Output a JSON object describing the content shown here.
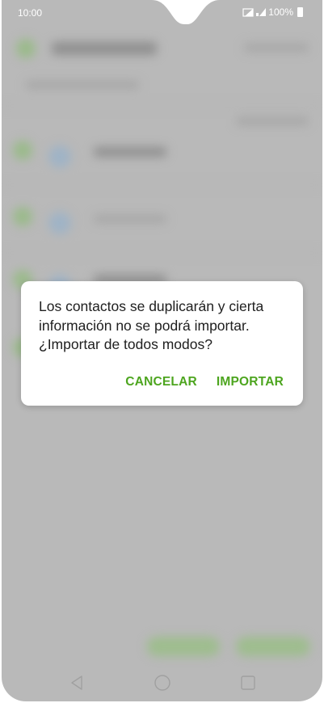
{
  "status_bar": {
    "time": "10:00",
    "battery": "100%",
    "icons": [
      "data-icon",
      "signal-icon",
      "battery-icon"
    ]
  },
  "dialog": {
    "message": "Los contactos se duplicarán y cierta información no se podrá importar. ¿Importar de todos modos?",
    "cancel_label": "CANCELAR",
    "import_label": "IMPORTAR"
  },
  "nav_bar": {
    "icons": [
      "back-icon",
      "home-icon",
      "recents-icon"
    ]
  },
  "colors": {
    "accent": "#4da51f",
    "scrim": "#b9b9b9",
    "dialog_bg": "#ffffff",
    "text": "#202020"
  }
}
